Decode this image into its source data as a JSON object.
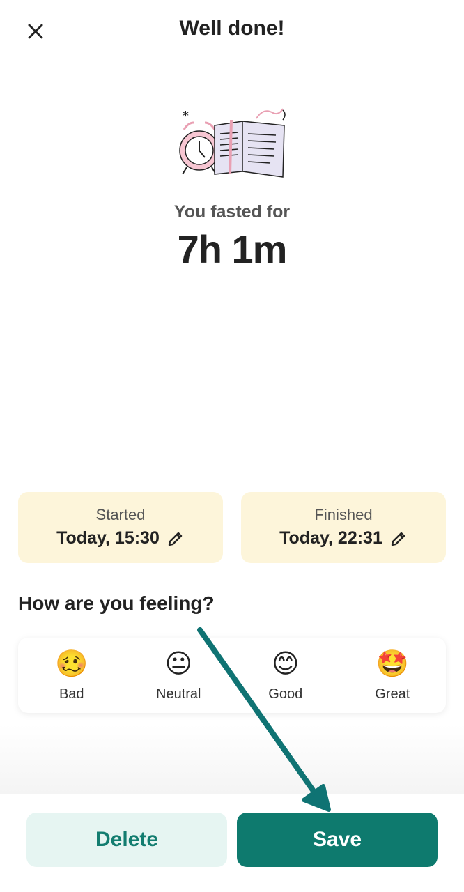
{
  "header": {
    "title": "Well done!",
    "close_icon": "close-icon"
  },
  "summary": {
    "subtitle": "You fasted for",
    "duration": "7h 1m"
  },
  "times": {
    "started": {
      "label": "Started",
      "value": "Today, 15:30"
    },
    "finished": {
      "label": "Finished",
      "value": "Today, 22:31"
    }
  },
  "feeling": {
    "question": "How are you feeling?",
    "moods": [
      {
        "label": "Bad",
        "emoji": "🥴"
      },
      {
        "label": "Neutral",
        "emoji": "😐"
      },
      {
        "label": "Good",
        "emoji": "😊"
      },
      {
        "label": "Great",
        "emoji": "🤩"
      }
    ]
  },
  "actions": {
    "delete_label": "Delete",
    "save_label": "Save"
  },
  "colors": {
    "accent": "#0e7a6e",
    "accent_light": "#e6f5f2",
    "card_bg": "#fdf5da",
    "annotation_arrow": "#0f7373"
  }
}
